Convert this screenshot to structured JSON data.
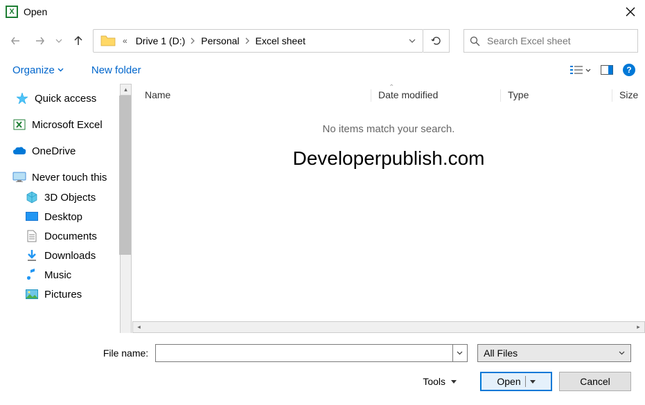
{
  "window": {
    "title": "Open"
  },
  "address": {
    "segments": [
      "Drive 1 (D:)",
      "Personal",
      "Excel sheet"
    ]
  },
  "search": {
    "placeholder": "Search Excel sheet"
  },
  "toolbar": {
    "organize": "Organize",
    "newfolder": "New folder"
  },
  "columns": {
    "name": "Name",
    "date": "Date modified",
    "type": "Type",
    "size": "Size"
  },
  "sidebar": {
    "quick_access": "Quick access",
    "excel": "Microsoft Excel",
    "onedrive": "OneDrive",
    "this_pc": "Never touch this",
    "items": [
      "3D Objects",
      "Desktop",
      "Documents",
      "Downloads",
      "Music",
      "Pictures"
    ]
  },
  "content": {
    "empty": "No items match your search.",
    "watermark": "Developerpublish.com"
  },
  "bottom": {
    "filename_label": "File name:",
    "filter": "All Files",
    "tools": "Tools",
    "open": "Open",
    "cancel": "Cancel"
  }
}
